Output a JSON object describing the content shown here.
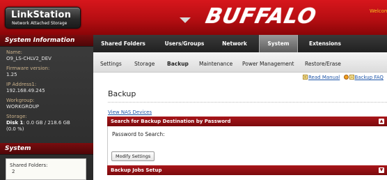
{
  "header": {
    "logo_title": "LinkStation",
    "logo_subtitle": "Network Attached Storage",
    "brand": "BUFFALO",
    "welcome": "Welcome"
  },
  "sidebar": {
    "info_title": "System Information",
    "info": [
      {
        "label": "Name:",
        "value": "O9_LS-CHLV2_DEV"
      },
      {
        "label": "Firmware version:",
        "value": "1.25"
      },
      {
        "label": "IP Address1:",
        "value": "192.168.49.245"
      },
      {
        "label": "Workgroup:",
        "value": "WORKGROUP"
      }
    ],
    "storage_label": "Storage:",
    "storage_disk": "Disk 1",
    "storage_value": ": 0.0 GB / 218.6 GB",
    "storage_percent": "(0.0 %)",
    "system_title": "System",
    "shared_label": "Shared Folders:",
    "shared_value": "2"
  },
  "topnav": [
    "Shared Folders",
    "Users/Groups",
    "Network",
    "System",
    "Extensions"
  ],
  "topnav_active": "System",
  "subnav": [
    "Settings",
    "Storage",
    "Backup",
    "Maintenance",
    "Power Management",
    "Restore/Erase"
  ],
  "subnav_active": "Backup",
  "content": {
    "read_manual": "Read Manual",
    "backup_help": "Backup FAQ",
    "title": "Backup",
    "view_nas": "View NAS Devices",
    "panel1_title": "Search for Backup Destination by Password",
    "password_label": "Password to Search:",
    "modify_button": "Modify Settings",
    "panel2_title": "Backup Jobs Setup"
  },
  "colors": {
    "header_red": "#c8141a",
    "panel_red": "#8b0a0d",
    "link_blue": "#1e55a8",
    "sidebar_dark": "#333333"
  }
}
